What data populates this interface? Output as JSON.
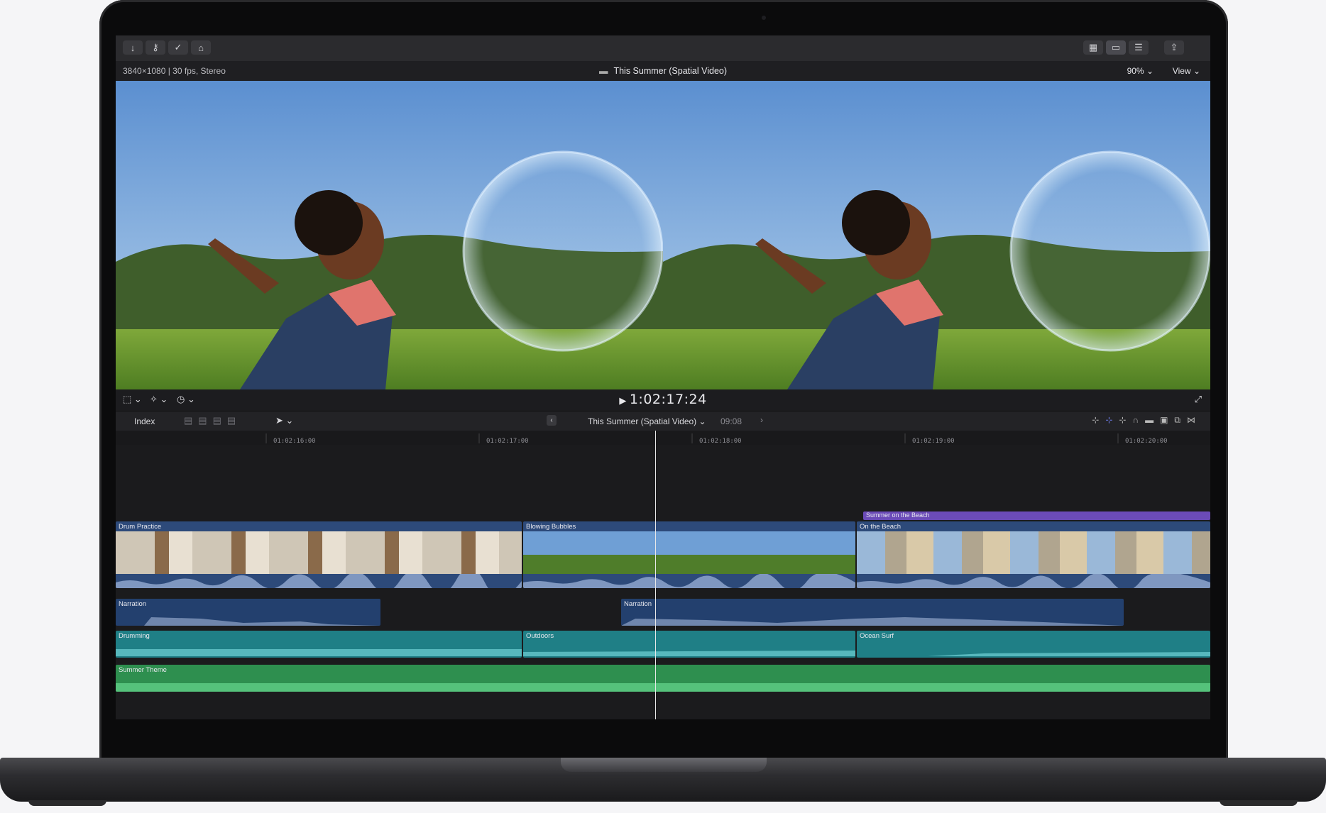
{
  "toolbar": {
    "left_icons": [
      "import-icon",
      "keyword-icon",
      "check-icon",
      "tag-icon"
    ],
    "right_icons": [
      "grid-icon",
      "filmstrip-icon",
      "inspector-icon",
      "share-icon"
    ]
  },
  "viewer": {
    "format_info": "3840×1080 | 30 fps, Stereo",
    "project_title": "This Summer (Spatial Video)",
    "zoom": "90%",
    "view_label": "View",
    "timecode": "1:02:17:24"
  },
  "timeline_bar": {
    "index_label": "Index",
    "project_title": "This Summer (Spatial Video)",
    "duration": "09:08"
  },
  "ruler": {
    "ticks": [
      "01:02:16:00",
      "01:02:17:00",
      "01:02:18:00",
      "01:02:19:00",
      "01:02:20:00"
    ]
  },
  "clips": {
    "title_clip": "Summer on the Beach",
    "video": [
      "Drum Practice",
      "Blowing Bubbles",
      "On the Beach"
    ],
    "narration": [
      "Narration",
      "Narration"
    ],
    "ambient": [
      "Drumming",
      "Outdoors",
      "Ocean Surf"
    ],
    "music": "Summer Theme"
  },
  "colors": {
    "video_clip": "#2d4a7a",
    "narration_clip": "#23406e",
    "ambient_clip": "#1f7f86",
    "music_clip": "#2e8f4f",
    "title_clip": "#6b4bb8"
  }
}
